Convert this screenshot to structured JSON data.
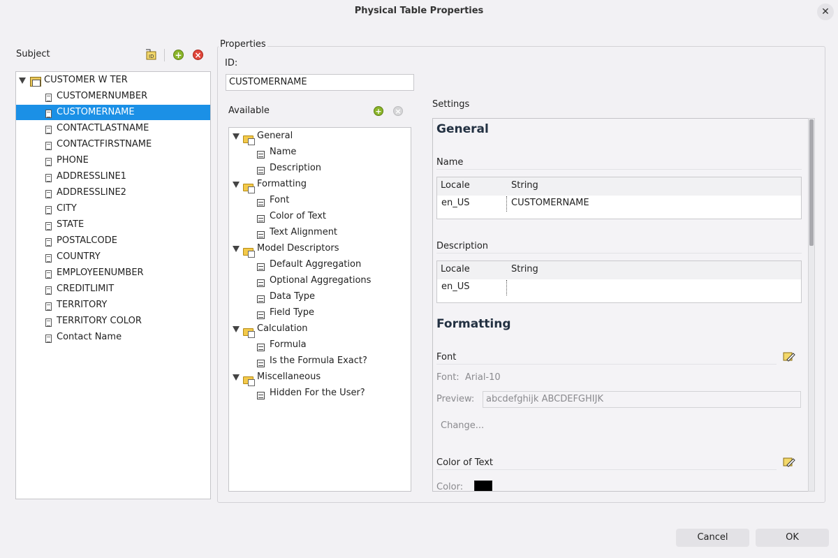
{
  "window": {
    "title": "Physical Table Properties"
  },
  "subject": {
    "label": "Subject",
    "root": "CUSTOMER W TER",
    "items": [
      "CUSTOMERNUMBER",
      "CUSTOMERNAME",
      "CONTACTLASTNAME",
      "CONTACTFIRSTNAME",
      "PHONE",
      "ADDRESSLINE1",
      "ADDRESSLINE2",
      "CITY",
      "STATE",
      "POSTALCODE",
      "COUNTRY",
      "EMPLOYEENUMBER",
      "CREDITLIMIT",
      "TERRITORY",
      "TERRITORY COLOR",
      "Contact Name"
    ],
    "selected": "CUSTOMERNAME"
  },
  "properties": {
    "label": "Properties",
    "id_label": "ID:",
    "id_value": "CUSTOMERNAME",
    "available_label": "Available",
    "settings_label": "Settings",
    "groups": [
      {
        "name": "General",
        "items": [
          "Name",
          "Description"
        ]
      },
      {
        "name": "Formatting",
        "items": [
          "Font",
          "Color of Text",
          "Text Alignment"
        ]
      },
      {
        "name": "Model Descriptors",
        "items": [
          "Default Aggregation",
          "Optional Aggregations",
          "Data Type",
          "Field Type"
        ]
      },
      {
        "name": "Calculation",
        "items": [
          "Formula",
          "Is the Formula Exact?"
        ]
      },
      {
        "name": "Miscellaneous",
        "items": [
          "Hidden For the User?"
        ]
      }
    ]
  },
  "settings": {
    "general_heading": "General",
    "name_label": "Name",
    "col_locale": "Locale",
    "col_string": "String",
    "name_locale": "en_US",
    "name_string": "CUSTOMERNAME",
    "description_label": "Description",
    "desc_locale": "en_US",
    "desc_string": "",
    "formatting_heading": "Formatting",
    "font_label": "Font",
    "font_key": "Font:",
    "font_value": "Arial-10",
    "preview_key": "Preview:",
    "preview_value": "abcdefghijk ABCDEFGHIJK",
    "change_label": "Change...",
    "color_label": "Color of Text",
    "color_key": "Color:",
    "color_value": "#000000"
  },
  "buttons": {
    "cancel": "Cancel",
    "ok": "OK"
  }
}
